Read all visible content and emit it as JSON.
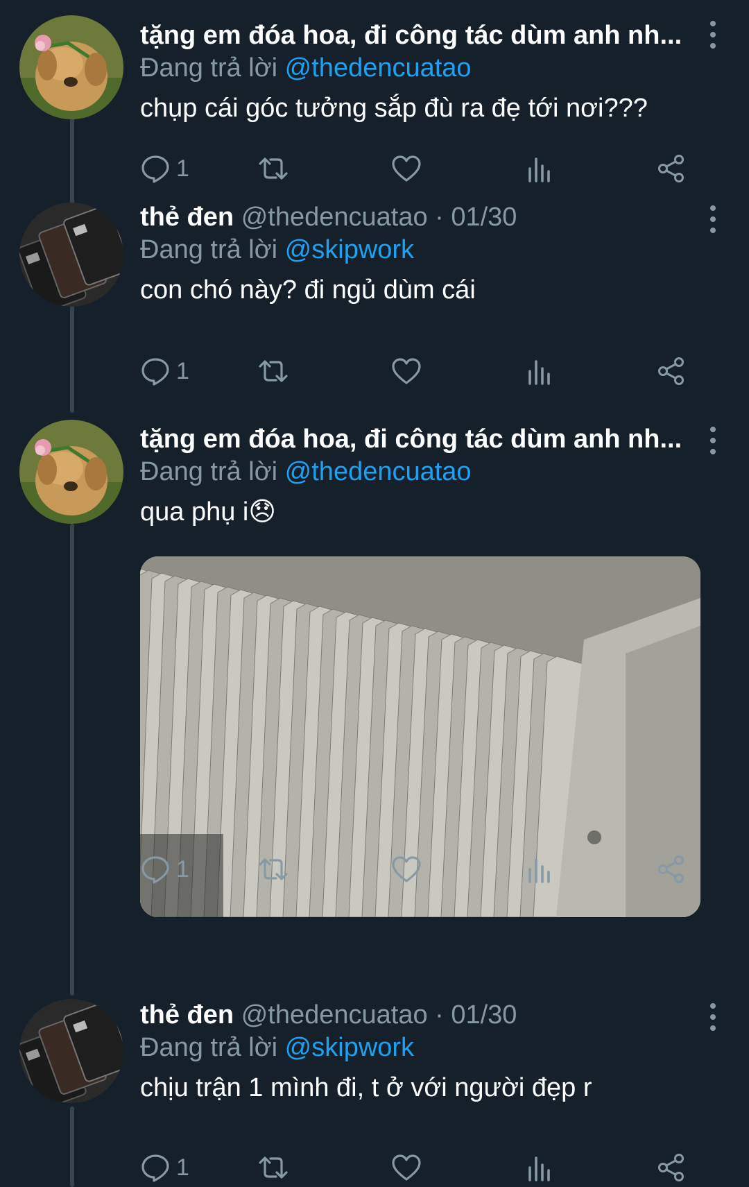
{
  "tweets": [
    {
      "author_name": "tặng em đóa hoa, đi công tác dùm anh nh...",
      "handle_meta": "",
      "replying_label": "Đang trả lời",
      "replying_to": "@thedencuatao",
      "text": "chụp cái góc tưởng sắp đù ra đẹ tới nơi???",
      "reply_count": "1",
      "avatar": "dog-with-flower"
    },
    {
      "author_name": "thẻ đen",
      "handle_meta": "@thedencuatao · 01/30",
      "replying_label": "Đang trả lời",
      "replying_to": "@skipwork",
      "text": "con chó này? đi ngủ dùm cái",
      "reply_count": "1",
      "avatar": "black-cards"
    },
    {
      "author_name": "tặng em đóa hoa, đi công tác dùm anh nh...",
      "handle_meta": "",
      "replying_label": "Đang trả lời",
      "replying_to": "@thedencuatao",
      "text": "qua phụ i",
      "emoji": "😞",
      "reply_count": "1",
      "avatar": "dog-with-flower",
      "media": "file-folders-photo"
    },
    {
      "author_name": "thẻ đen",
      "handle_meta": "@thedencuatao · 01/30",
      "replying_label": "Đang trả lời",
      "replying_to": "@skipwork",
      "text": "chịu trận 1 mình đi, t ở với người đẹp r",
      "reply_count": "1",
      "avatar": "black-cards"
    }
  ],
  "icons": {
    "reply": "reply-icon",
    "retweet": "retweet-icon",
    "like": "like-icon",
    "analytics": "analytics-icon",
    "share": "share-icon",
    "more": "more-options-icon"
  },
  "colors": {
    "background": "#15202b",
    "secondary_text": "#8899a6",
    "mention": "#1da1f2",
    "thread_line": "#38444d"
  }
}
